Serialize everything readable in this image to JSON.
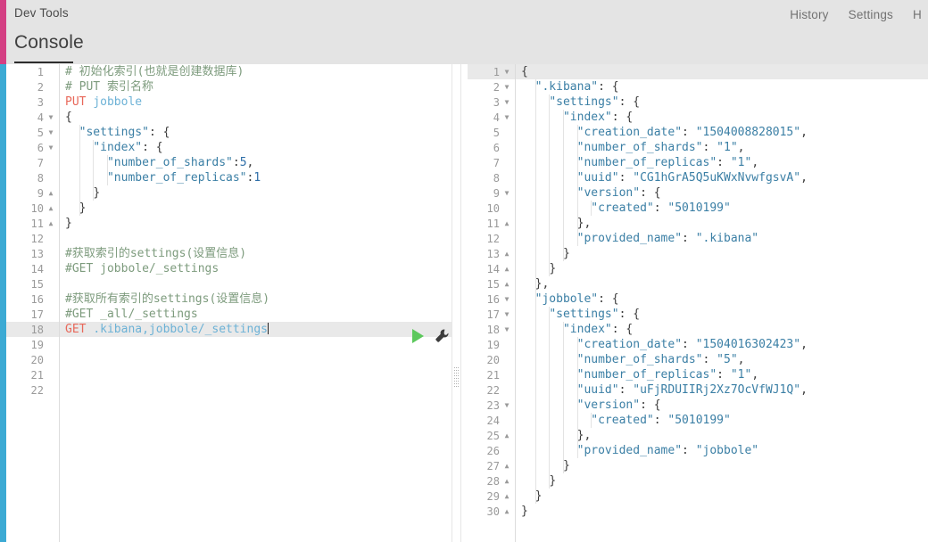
{
  "header": {
    "app_title": "Dev Tools",
    "nav": [
      {
        "label": "History"
      },
      {
        "label": "Settings"
      },
      {
        "label": "Help"
      }
    ]
  },
  "console": {
    "tab_label": "Console"
  },
  "colors": {
    "rail_top": "#d43f83",
    "rail_bottom": "#3caad4",
    "header_bg": "#e4e4e4",
    "method": "#e8685a",
    "url": "#6db2d6",
    "string": "#3b7fa5",
    "comment": "#7d9b7d",
    "active_line": "#e9e9e9",
    "play": "#5cc85c"
  },
  "icons": {
    "play": "play-icon",
    "wrench": "wrench-icon",
    "drag_handle": "splitter-drag-handle"
  },
  "request_editor": {
    "name": "request-editor",
    "total_lines": 22,
    "active_line": 18,
    "lines": [
      {
        "n": 1,
        "fold": "",
        "text": "# 初始化索引(也就是创建数据库)"
      },
      {
        "n": 2,
        "fold": "",
        "text": "# PUT 索引名称"
      },
      {
        "n": 3,
        "fold": "",
        "text": "PUT jobbole"
      },
      {
        "n": 4,
        "fold": "down",
        "text": "{"
      },
      {
        "n": 5,
        "fold": "down",
        "text": "  \"settings\": {"
      },
      {
        "n": 6,
        "fold": "down",
        "text": "    \"index\": {"
      },
      {
        "n": 7,
        "fold": "",
        "text": "      \"number_of_shards\":5,"
      },
      {
        "n": 8,
        "fold": "",
        "text": "      \"number_of_replicas\":1"
      },
      {
        "n": 9,
        "fold": "up",
        "text": "    }"
      },
      {
        "n": 10,
        "fold": "up",
        "text": "  }"
      },
      {
        "n": 11,
        "fold": "up",
        "text": "}"
      },
      {
        "n": 12,
        "fold": "",
        "text": ""
      },
      {
        "n": 13,
        "fold": "",
        "text": "#获取索引的settings(设置信息)"
      },
      {
        "n": 14,
        "fold": "",
        "text": "#GET jobbole/_settings"
      },
      {
        "n": 15,
        "fold": "",
        "text": ""
      },
      {
        "n": 16,
        "fold": "",
        "text": "#获取所有索引的settings(设置信息)"
      },
      {
        "n": 17,
        "fold": "",
        "text": "#GET _all/_settings"
      },
      {
        "n": 18,
        "fold": "",
        "text": "GET .kibana,jobbole/_settings"
      },
      {
        "n": 19,
        "fold": "",
        "text": ""
      },
      {
        "n": 20,
        "fold": "",
        "text": ""
      },
      {
        "n": 21,
        "fold": "",
        "text": ""
      },
      {
        "n": 22,
        "fold": "",
        "text": ""
      }
    ]
  },
  "response_editor": {
    "name": "response-viewer",
    "total_lines": 30,
    "active_line": 1,
    "lines": [
      {
        "n": 1,
        "fold": "down",
        "text": "{"
      },
      {
        "n": 2,
        "fold": "down",
        "text": "  \".kibana\": {"
      },
      {
        "n": 3,
        "fold": "down",
        "text": "    \"settings\": {"
      },
      {
        "n": 4,
        "fold": "down",
        "text": "      \"index\": {"
      },
      {
        "n": 5,
        "fold": "",
        "text": "        \"creation_date\": \"1504008828015\","
      },
      {
        "n": 6,
        "fold": "",
        "text": "        \"number_of_shards\": \"1\","
      },
      {
        "n": 7,
        "fold": "",
        "text": "        \"number_of_replicas\": \"1\","
      },
      {
        "n": 8,
        "fold": "",
        "text": "        \"uuid\": \"CG1hGrA5Q5uKWxNvwfgsvA\","
      },
      {
        "n": 9,
        "fold": "down",
        "text": "        \"version\": {"
      },
      {
        "n": 10,
        "fold": "",
        "text": "          \"created\": \"5010199\""
      },
      {
        "n": 11,
        "fold": "up",
        "text": "        },"
      },
      {
        "n": 12,
        "fold": "",
        "text": "        \"provided_name\": \".kibana\""
      },
      {
        "n": 13,
        "fold": "up",
        "text": "      }"
      },
      {
        "n": 14,
        "fold": "up",
        "text": "    }"
      },
      {
        "n": 15,
        "fold": "up",
        "text": "  },"
      },
      {
        "n": 16,
        "fold": "down",
        "text": "  \"jobbole\": {"
      },
      {
        "n": 17,
        "fold": "down",
        "text": "    \"settings\": {"
      },
      {
        "n": 18,
        "fold": "down",
        "text": "      \"index\": {"
      },
      {
        "n": 19,
        "fold": "",
        "text": "        \"creation_date\": \"1504016302423\","
      },
      {
        "n": 20,
        "fold": "",
        "text": "        \"number_of_shards\": \"5\","
      },
      {
        "n": 21,
        "fold": "",
        "text": "        \"number_of_replicas\": \"1\","
      },
      {
        "n": 22,
        "fold": "",
        "text": "        \"uuid\": \"uFjRDUIIRj2Xz7OcVfWJ1Q\","
      },
      {
        "n": 23,
        "fold": "down",
        "text": "        \"version\": {"
      },
      {
        "n": 24,
        "fold": "",
        "text": "          \"created\": \"5010199\""
      },
      {
        "n": 25,
        "fold": "up",
        "text": "        },"
      },
      {
        "n": 26,
        "fold": "",
        "text": "        \"provided_name\": \"jobbole\""
      },
      {
        "n": 27,
        "fold": "up",
        "text": "      }"
      },
      {
        "n": 28,
        "fold": "up",
        "text": "    }"
      },
      {
        "n": 29,
        "fold": "up",
        "text": "  }"
      },
      {
        "n": 30,
        "fold": "up",
        "text": "}"
      }
    ]
  }
}
